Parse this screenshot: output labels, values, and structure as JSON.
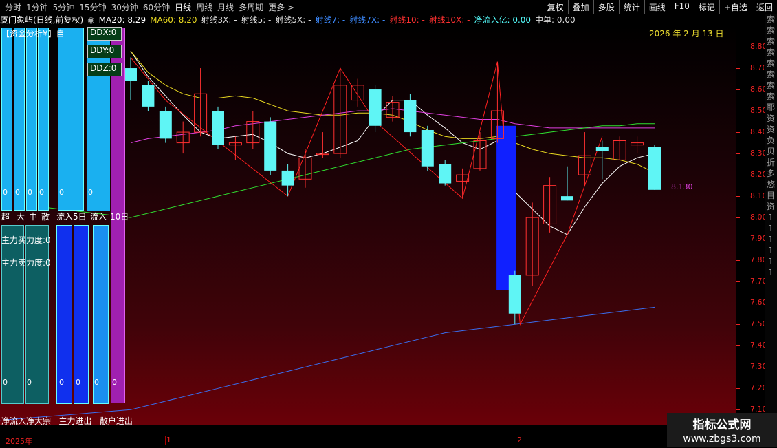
{
  "toolbar": {
    "tabs": [
      "分时",
      "1分钟",
      "5分钟",
      "15分钟",
      "30分钟",
      "60分钟",
      "日线",
      "周线",
      "月线",
      "多周期",
      "更多"
    ],
    "active_tab": "日线",
    "right_buttons": [
      "复权",
      "叠加",
      "多股",
      "统计",
      "画线",
      "F10",
      "标记",
      "+自选",
      "返回"
    ]
  },
  "info": {
    "stock": "厦门象屿(日线,前复权)",
    "ma20": "MA20: 8.29",
    "ma60": "MA60: 8.20",
    "items": [
      {
        "text": "射线3X: -",
        "color": "#ddd"
      },
      {
        "text": "射线5: -",
        "color": "#ddd"
      },
      {
        "text": "射线5X: -",
        "color": "#ddd"
      },
      {
        "text": "射线7: -",
        "color": "#3d8bff"
      },
      {
        "text": "射线7X: -",
        "color": "#3d8bff"
      },
      {
        "text": "射线10: -",
        "color": "#ff3030"
      },
      {
        "text": "射线10X: -",
        "color": "#ff3030"
      },
      {
        "text": "净流入亿: 0.00",
        "color": "#5ff"
      },
      {
        "text": "中单: 0.00",
        "color": "#ddd"
      }
    ]
  },
  "date_label": "2026 年 2 月 13 日",
  "last_price": "8.130",
  "price_axis": [
    "8.80",
    "8.70",
    "8.60",
    "8.50",
    "8.40",
    "8.30",
    "8.20",
    "8.10",
    "8.00",
    "7.90",
    "7.80",
    "7.70",
    "7.60",
    "7.50",
    "7.40",
    "7.30",
    "7.20",
    "7.10"
  ],
  "side_text": [
    "索",
    "索",
    "索",
    "索",
    "索",
    "索",
    "索",
    "索",
    "耶",
    "资",
    "资",
    "负",
    "贝",
    "折",
    "多",
    "悠",
    "目",
    "资",
    "1",
    "1",
    "1",
    "1",
    "1",
    "1"
  ],
  "panel": {
    "title": "【资金分析¥】自",
    "ddx": "DDX:0",
    "ddy": "DDY:0",
    "ddz": "DDZ:0",
    "headers": [
      "超",
      "大",
      "中",
      "散",
      "流入",
      "5日",
      "流入",
      "10日"
    ],
    "buy": "主力买力度:0",
    "sell": "主力卖力度:0",
    "zero": "0",
    "bottom_labels": "净流入净大宗   主力进出   散户进出"
  },
  "timeline": {
    "labels": [
      "2025年",
      "1",
      "2"
    ]
  },
  "watermark": {
    "title": "指标公式网",
    "url": "www.zbgs3.com"
  },
  "chart_data": {
    "type": "candlestick",
    "ylim": [
      7.03,
      8.9
    ],
    "candles": [
      {
        "o": 8.7,
        "c": 8.64,
        "h": 8.75,
        "l": 8.55
      },
      {
        "o": 8.62,
        "c": 8.52,
        "h": 8.64,
        "l": 8.5
      },
      {
        "o": 8.5,
        "c": 8.37,
        "h": 8.52,
        "l": 8.35
      },
      {
        "o": 8.35,
        "c": 8.4,
        "h": 8.45,
        "l": 8.3
      },
      {
        "o": 8.4,
        "c": 8.58,
        "h": 8.7,
        "l": 8.38
      },
      {
        "o": 8.5,
        "c": 8.34,
        "h": 8.52,
        "l": 8.32
      },
      {
        "o": 8.34,
        "c": 8.35,
        "h": 8.38,
        "l": 8.27
      },
      {
        "o": 8.35,
        "c": 8.45,
        "h": 8.5,
        "l": 8.32
      },
      {
        "o": 8.45,
        "c": 8.22,
        "h": 8.47,
        "l": 8.2
      },
      {
        "o": 8.22,
        "c": 8.15,
        "h": 8.25,
        "l": 8.1
      },
      {
        "o": 8.18,
        "c": 8.28,
        "h": 8.32,
        "l": 8.14
      },
      {
        "o": 8.3,
        "c": 8.3,
        "h": 8.4,
        "l": 8.28
      },
      {
        "o": 8.3,
        "c": 8.62,
        "h": 8.7,
        "l": 8.28
      },
      {
        "o": 8.55,
        "c": 8.62,
        "h": 8.65,
        "l": 8.52
      },
      {
        "o": 8.6,
        "c": 8.43,
        "h": 8.62,
        "l": 8.4
      },
      {
        "o": 8.47,
        "c": 8.54,
        "h": 8.57,
        "l": 8.45
      },
      {
        "o": 8.55,
        "c": 8.4,
        "h": 8.58,
        "l": 8.38
      },
      {
        "o": 8.41,
        "c": 8.24,
        "h": 8.43,
        "l": 8.22
      },
      {
        "o": 8.25,
        "c": 8.16,
        "h": 8.27,
        "l": 8.15
      },
      {
        "o": 8.17,
        "c": 8.2,
        "h": 8.23,
        "l": 8.09
      },
      {
        "o": 8.23,
        "c": 8.36,
        "h": 8.4,
        "l": 8.22
      },
      {
        "o": 8.37,
        "c": 8.5,
        "h": 8.73,
        "l": 8.35
      },
      {
        "o": 7.73,
        "c": 7.55,
        "h": 7.75,
        "l": 7.5
      },
      {
        "o": 7.73,
        "c": 8.0,
        "h": 8.07,
        "l": 7.68
      },
      {
        "o": 7.97,
        "c": 8.15,
        "h": 8.19,
        "l": 7.93
      },
      {
        "o": 8.1,
        "c": 8.08,
        "h": 8.24,
        "l": 8.08
      },
      {
        "o": 8.2,
        "c": 8.29,
        "h": 8.4,
        "l": 8.15
      },
      {
        "o": 8.33,
        "c": 8.31,
        "h": 8.36,
        "l": 8.18
      },
      {
        "o": 8.27,
        "c": 8.36,
        "h": 8.38,
        "l": 8.27
      },
      {
        "o": 8.34,
        "c": 8.35,
        "h": 8.38,
        "l": 8.3
      },
      {
        "o": 8.33,
        "c": 8.13,
        "h": 8.34,
        "l": 8.13
      }
    ],
    "big_bar": {
      "index": 21.5,
      "top": 8.43,
      "bottom": 7.66
    },
    "lines": [
      {
        "name": "白线",
        "color": "#ffffff",
        "values": [
          8.78,
          8.66,
          8.57,
          8.48,
          8.4,
          8.37,
          8.38,
          8.39,
          8.35,
          8.3,
          8.28,
          8.3,
          8.33,
          8.36,
          8.47,
          8.55,
          8.55,
          8.48,
          8.42,
          8.35,
          8.32,
          8.36,
          8.12,
          8.04,
          7.96,
          7.92,
          8.05,
          8.16,
          8.24,
          8.28,
          8.3
        ]
      },
      {
        "name": "黄线",
        "color": "#e8d820",
        "values": [
          8.78,
          8.68,
          8.62,
          8.58,
          8.56,
          8.56,
          8.57,
          8.56,
          8.53,
          8.5,
          8.49,
          8.48,
          8.48,
          8.49,
          8.49,
          8.48,
          8.45,
          8.41,
          8.38,
          8.37,
          8.37,
          8.38,
          8.35,
          8.32,
          8.3,
          8.29,
          8.28,
          8.28,
          8.27,
          8.25,
          8.21
        ]
      },
      {
        "name": "紫线",
        "color": "#e040e0",
        "values": [
          8.35,
          8.37,
          8.38,
          8.39,
          8.4,
          8.41,
          8.43,
          8.44,
          8.45,
          8.46,
          8.47,
          8.48,
          8.49,
          8.5,
          8.5,
          8.51,
          8.5,
          8.49,
          8.48,
          8.47,
          8.46,
          8.46,
          8.44,
          8.43,
          8.42,
          8.42,
          8.42,
          8.42,
          8.42,
          8.42,
          8.42
        ]
      },
      {
        "name": "绿线",
        "color": "#30e030",
        "values": [
          8.0,
          8.02,
          8.04,
          8.06,
          8.08,
          8.1,
          8.12,
          8.14,
          8.16,
          8.18,
          8.2,
          8.22,
          8.24,
          8.26,
          8.28,
          8.3,
          8.32,
          8.33,
          8.34,
          8.35,
          8.36,
          8.37,
          8.38,
          8.39,
          8.4,
          8.41,
          8.42,
          8.43,
          8.43,
          8.44,
          8.44
        ]
      },
      {
        "name": "蓝线",
        "color": "#3a6ef0",
        "values": [
          7.1,
          7.12,
          7.14,
          7.16,
          7.18,
          7.2,
          7.22,
          7.24,
          7.26,
          7.28,
          7.3,
          7.32,
          7.34,
          7.36,
          7.38,
          7.4,
          7.42,
          7.44,
          7.46,
          7.47,
          7.48,
          7.49,
          7.5,
          7.51,
          7.52,
          7.53,
          7.54,
          7.55,
          7.56,
          7.57,
          7.58
        ]
      }
    ],
    "zigzag": [
      [
        0,
        8.75
      ],
      [
        2,
        8.55
      ],
      [
        9,
        8.1
      ],
      [
        12,
        8.7
      ],
      [
        14,
        8.45
      ],
      [
        19,
        8.09
      ],
      [
        21,
        8.73
      ],
      [
        22.3,
        7.5
      ],
      [
        25,
        7.92
      ],
      [
        27,
        8.38
      ]
    ]
  }
}
